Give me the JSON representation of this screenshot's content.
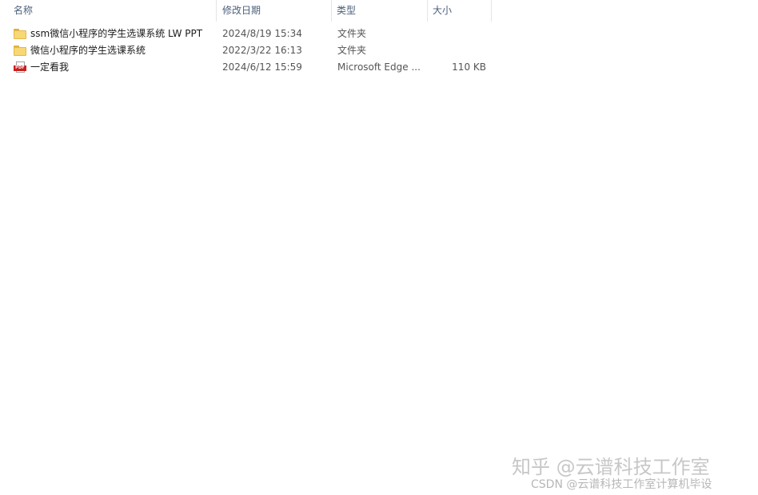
{
  "columns": {
    "name": "名称",
    "date": "修改日期",
    "type": "类型",
    "size": "大小"
  },
  "sort": {
    "indicator": "^"
  },
  "files": [
    {
      "icon": "folder-icon",
      "name": "ssm微信小程序的学生选课系统  LW  PPT",
      "date": "2024/8/19 15:34",
      "type": "文件夹",
      "size": ""
    },
    {
      "icon": "folder-icon",
      "name": "微信小程序的学生选课系统",
      "date": "2022/3/22 16:13",
      "type": "文件夹",
      "size": ""
    },
    {
      "icon": "pdf-icon",
      "badge": "PDF",
      "name": "一定看我",
      "date": "2024/6/12 15:59",
      "type": "Microsoft Edge ...",
      "size": "110 KB"
    }
  ],
  "watermarks": {
    "zhihu": "知乎 @云谱科技工作室",
    "csdn": "CSDN @云谱科技工作室计算机毕设"
  }
}
